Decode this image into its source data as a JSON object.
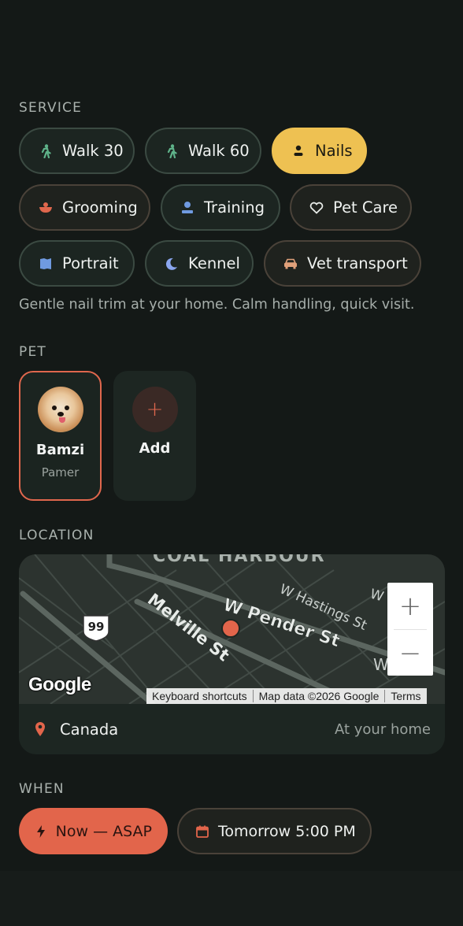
{
  "service": {
    "label": "SERVICE",
    "chips": [
      {
        "label": "Walk 30",
        "icon": "walking-icon",
        "selected": false
      },
      {
        "label": "Walk 60",
        "icon": "walking-icon",
        "selected": false
      },
      {
        "label": "Nails",
        "icon": "person-icon",
        "selected": true
      },
      {
        "label": "Grooming",
        "icon": "bowl-icon",
        "selected": false
      },
      {
        "label": "Training",
        "icon": "person-icon",
        "selected": false
      },
      {
        "label": "Pet Care",
        "icon": "heart-icon",
        "selected": false
      },
      {
        "label": "Portrait",
        "icon": "portrait-icon",
        "selected": false
      },
      {
        "label": "Kennel",
        "icon": "moon-icon",
        "selected": false
      },
      {
        "label": "Vet transport",
        "icon": "car-icon",
        "selected": false
      }
    ],
    "description": "Gentle nail trim at your home. Calm handling, quick visit."
  },
  "pet": {
    "label": "PET",
    "selected": {
      "name": "Bamzi",
      "breed": "Pamer"
    },
    "add_label": "Add",
    "add_symbol": "+"
  },
  "location": {
    "label": "LOCATION",
    "map": {
      "area_label": "COAL HARBOUR",
      "streets": [
        "W Pender St",
        "Melville St",
        "W Hastings St",
        "W Ge",
        "W"
      ],
      "route_shield": "99",
      "zoom_in": "+",
      "zoom_out": "−",
      "logo": "Google",
      "attribution": [
        "Keyboard shortcuts",
        "Map data ©2026 Google",
        "Terms"
      ]
    },
    "place": "Canada",
    "hint": "At your home"
  },
  "when": {
    "label": "WHEN",
    "asap": "Now — ASAP",
    "scheduled": "Tomorrow 5:00 PM"
  },
  "colors": {
    "background": "#131816",
    "accent_selected": "#eec152",
    "accent_primary": "#e2654b",
    "walk_icon": "#5fb38a"
  }
}
